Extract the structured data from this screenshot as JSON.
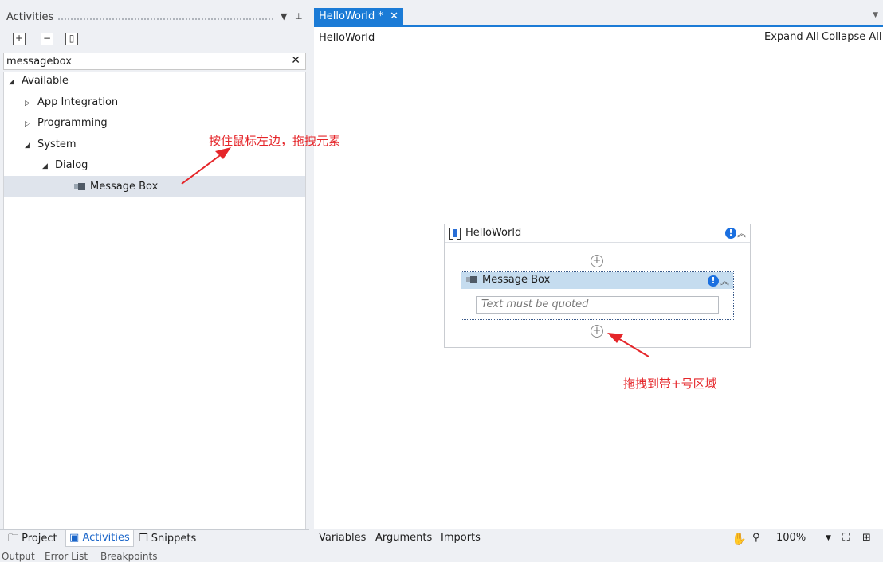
{
  "left_panel": {
    "title": "Activities",
    "search_value": "messagebox",
    "tree": {
      "available": "Available",
      "app_integration": "App Integration",
      "programming": "Programming",
      "system": "System",
      "dialog": "Dialog",
      "message_box": "Message Box"
    },
    "bottom_tabs": {
      "project": "Project",
      "activities": "Activities",
      "snippets": "Snippets"
    }
  },
  "output_bar": {
    "output": "Output",
    "error_list": "Error List",
    "breakpoints": "Breakpoints"
  },
  "designer": {
    "tab_label": "HelloWorld *",
    "breadcrumb": "HelloWorld",
    "expand_all": "Expand All",
    "collapse_all": "Collapse All",
    "sequence_title": "HelloWorld",
    "activity_title": "Message Box",
    "text_placeholder": "Text must be quoted",
    "status": {
      "variables": "Variables",
      "arguments": "Arguments",
      "imports": "Imports",
      "zoom": "100%"
    }
  },
  "annotations": {
    "drag_hint": "按住鼠标左边，拖拽元素",
    "drop_hint": "拖拽到带+号区域"
  },
  "colors": {
    "accent": "#1b7bd6",
    "annotation": "#e5262a",
    "selection": "#c5dcef"
  }
}
